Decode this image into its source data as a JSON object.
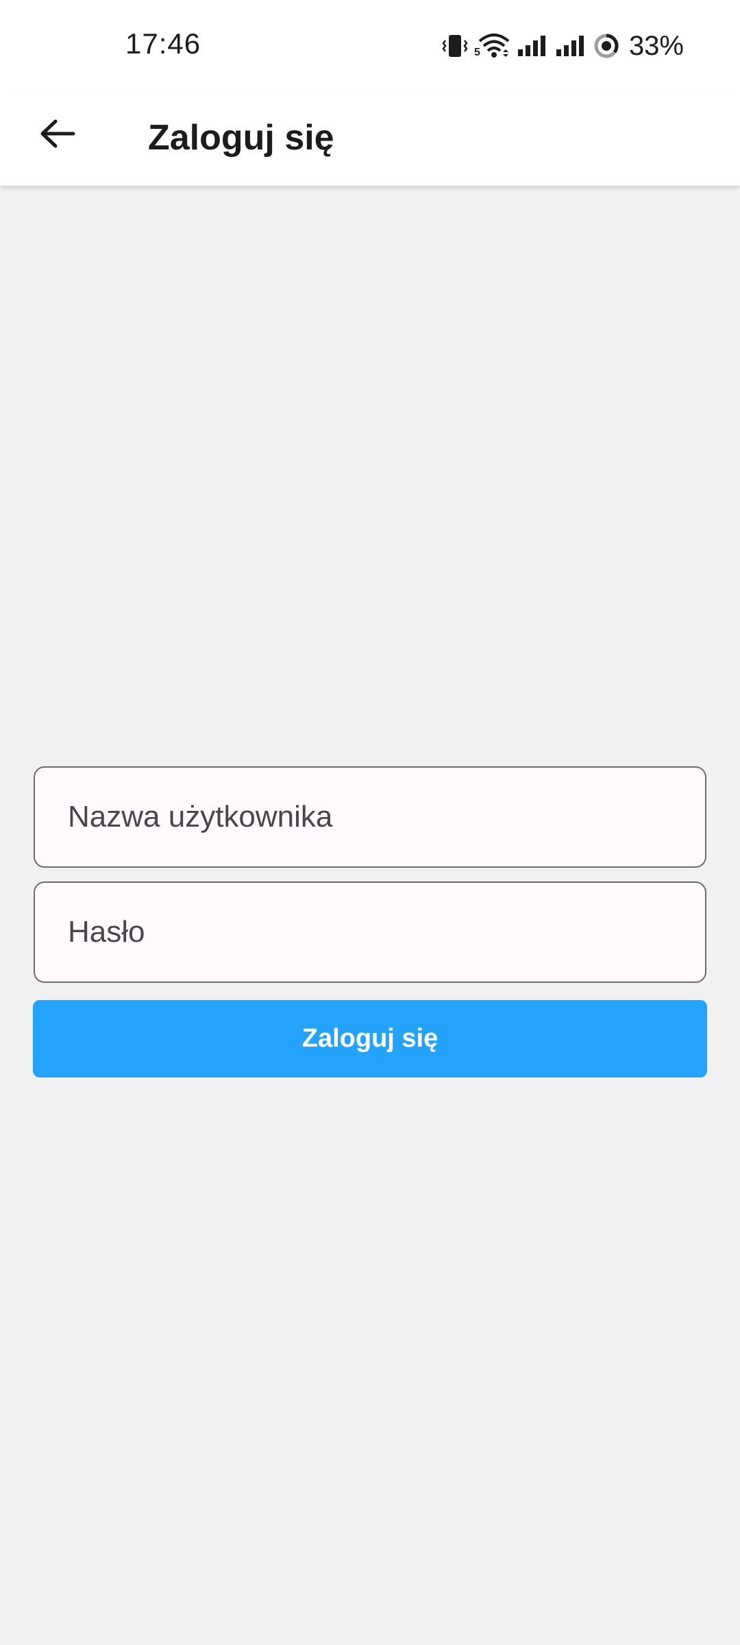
{
  "status_bar": {
    "time": "17:46",
    "battery_percent": "33%",
    "wifi_badge": "5",
    "icons": [
      "vibrate-icon",
      "wifi-icon",
      "signal-icon",
      "signal-icon",
      "battery-saver-icon"
    ]
  },
  "app_bar": {
    "back_icon": "arrow-left-icon",
    "title": "Zaloguj się"
  },
  "form": {
    "username_placeholder": "Nazwa użytkownika",
    "username_value": "",
    "password_placeholder": "Hasło",
    "password_value": "",
    "submit_label": "Zaloguj się"
  },
  "colors": {
    "primary_button": "#23a3fb",
    "background": "#f1f1f1",
    "app_bar": "#ffffff",
    "field_fill": "#fdf9fc",
    "field_border": "#6f6a72"
  }
}
